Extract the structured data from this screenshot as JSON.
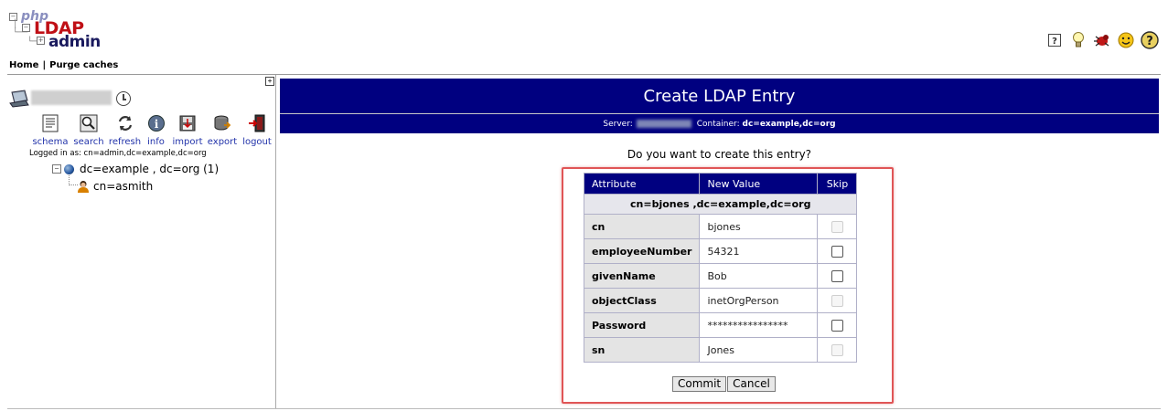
{
  "logo": {
    "php": "php",
    "ldap": "LDAP",
    "admin": "admin"
  },
  "header_icons": [
    "help-icon",
    "idea-bulb-icon",
    "bug-icon",
    "smiley-icon",
    "question-circle-icon"
  ],
  "menu": {
    "home": "Home",
    "separator": "|",
    "purge": "Purge caches"
  },
  "sidebar": {
    "expand_symbol": "+",
    "tools": [
      {
        "label": "schema",
        "icon": "schema-icon"
      },
      {
        "label": "search",
        "icon": "search-icon"
      },
      {
        "label": "refresh",
        "icon": "refresh-icon"
      },
      {
        "label": "info",
        "icon": "info-icon"
      },
      {
        "label": "import",
        "icon": "import-icon"
      },
      {
        "label": "export",
        "icon": "export-icon"
      },
      {
        "label": "logout",
        "icon": "logout-icon"
      }
    ],
    "logged_in": "Logged in as: cn=admin,dc=example,dc=org",
    "tree": {
      "root_toggle": "−",
      "root_label": "dc=example , dc=org (1)",
      "child_label": "cn=asmith"
    }
  },
  "main": {
    "title": "Create LDAP Entry",
    "server_label": "Server:",
    "container_label": "Container:",
    "container_value": "dc=example,dc=org",
    "question": "Do you want to create this entry?",
    "table": {
      "headers": {
        "attribute": "Attribute",
        "new_value": "New Value",
        "skip": "Skip"
      },
      "dn": "cn=bjones ,dc=example,dc=org",
      "rows": [
        {
          "attr": "cn",
          "value": "bjones",
          "skip_enabled": false
        },
        {
          "attr": "employeeNumber",
          "value": "54321",
          "skip_enabled": true
        },
        {
          "attr": "givenName",
          "value": "Bob",
          "skip_enabled": true
        },
        {
          "attr": "objectClass",
          "value": "inetOrgPerson",
          "skip_enabled": false
        },
        {
          "attr": "Password",
          "value": "****************",
          "skip_enabled": true
        },
        {
          "attr": "sn",
          "value": "Jones",
          "skip_enabled": false
        }
      ]
    },
    "buttons": {
      "commit": "Commit",
      "cancel": "Cancel"
    }
  },
  "colors": {
    "header_bg": "#000080",
    "highlight_border": "#e05556",
    "attr_bg": "#e4e4e4"
  }
}
